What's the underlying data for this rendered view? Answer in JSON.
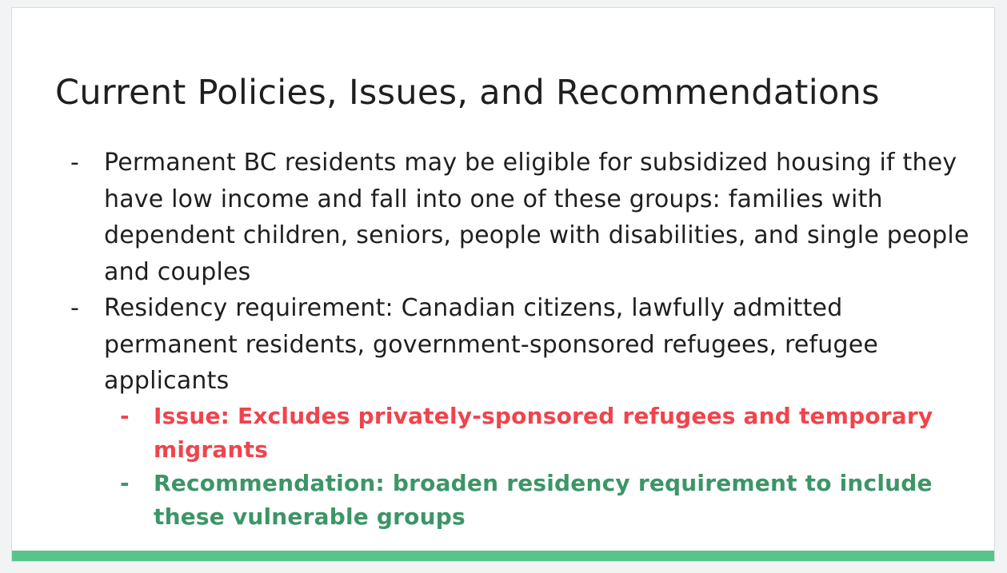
{
  "slide": {
    "title": "Current Policies, Issues, and Recommendations",
    "bullets": [
      {
        "marker": "-",
        "text": "Permanent BC residents may be eligible for subsidized housing if they have low income and fall into one of these groups: families with dependent children, seniors, people with disabilities, and single people and couples"
      },
      {
        "marker": "-",
        "text": "Residency requirement: Canadian citizens, lawfully admitted permanent residents, government-sponsored refugees, refugee applicants",
        "sub_bullets": [
          {
            "marker": "-",
            "text": "Issue: Excludes privately-sponsored refugees and temporary migrants",
            "color": "#f0444d"
          },
          {
            "marker": "-",
            "text": "Recommendation: broaden residency requirement to include these vulnerable groups",
            "color": "#3c9567"
          }
        ]
      }
    ],
    "accent_color": "#57c58a"
  }
}
